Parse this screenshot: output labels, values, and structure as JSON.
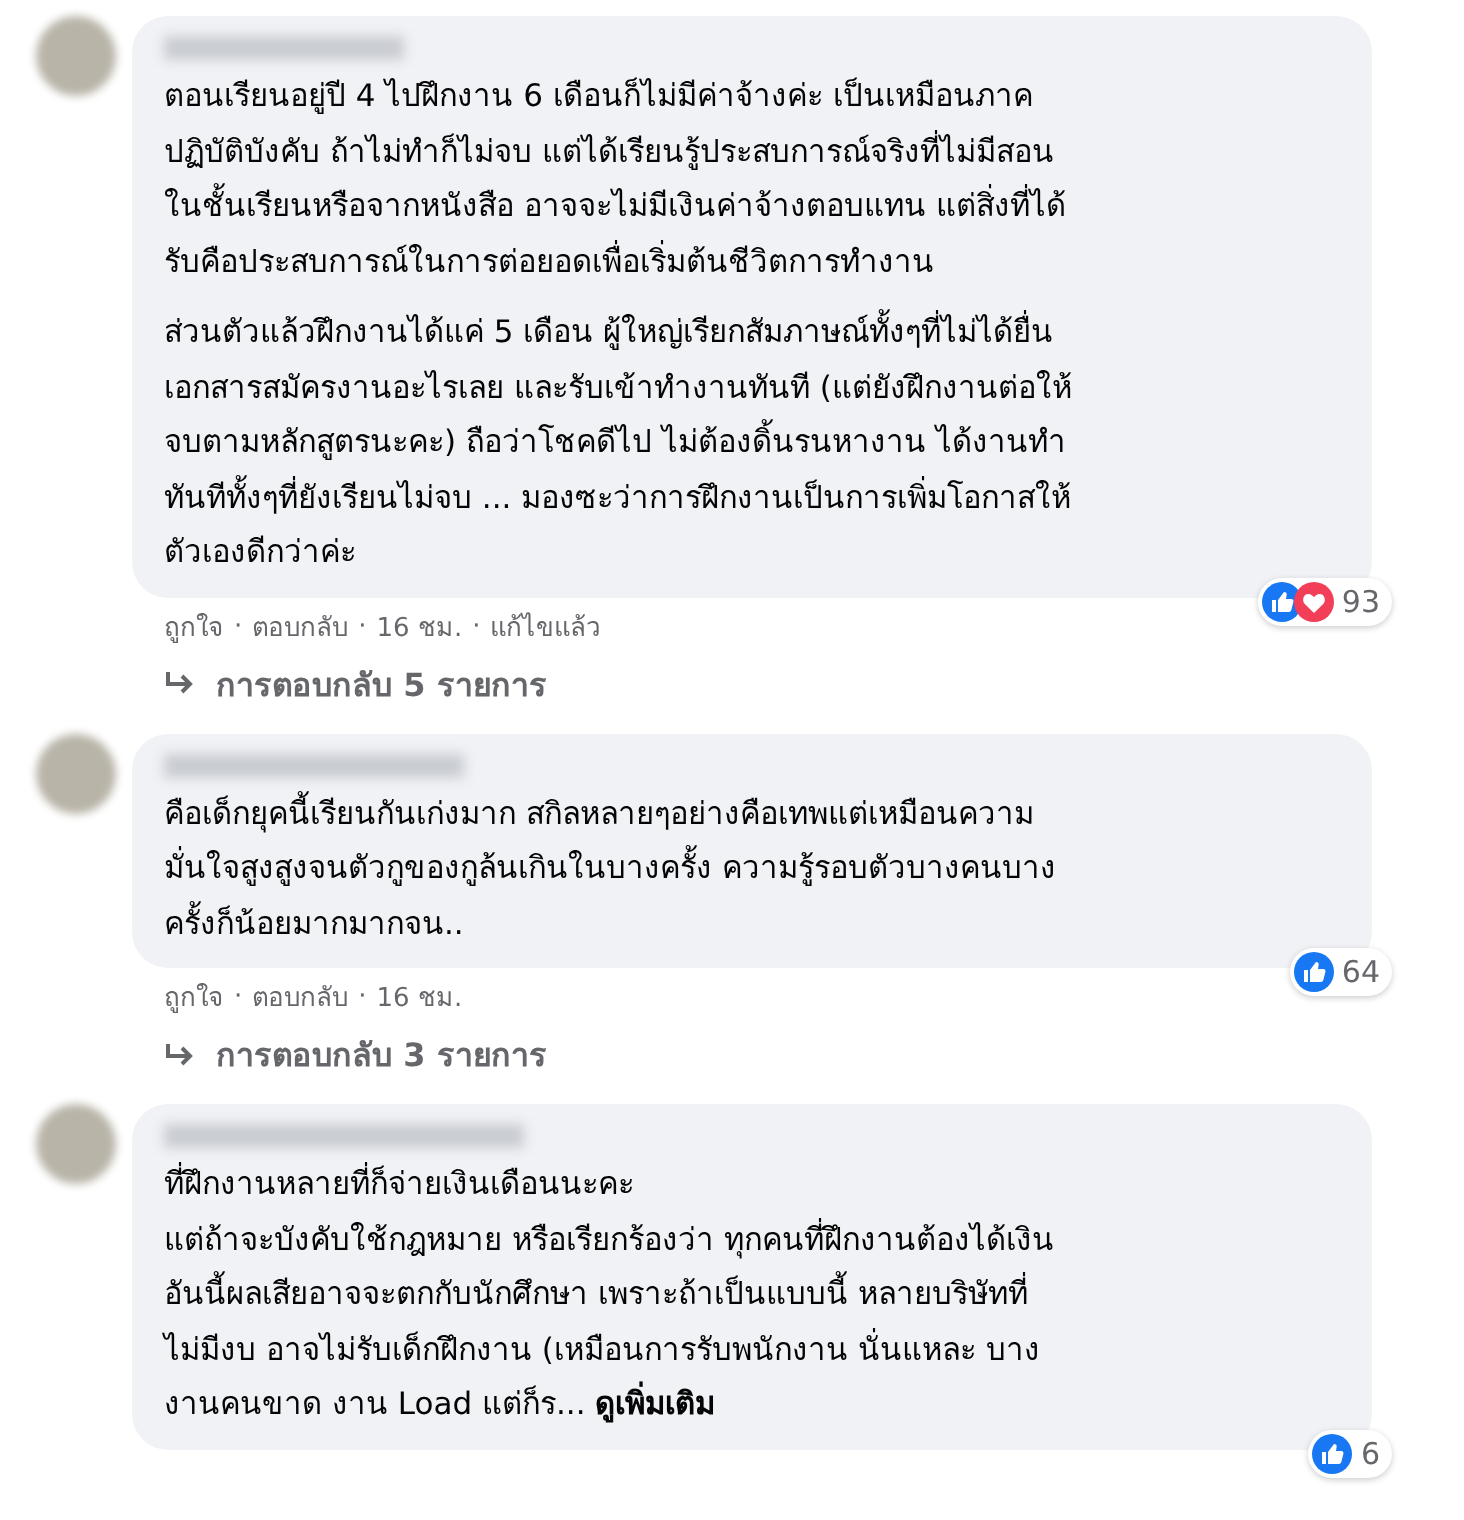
{
  "comments": [
    {
      "paragraphs": [
        "ตอนเรียนอยู่ปี 4 ไปฝึกงาน 6 เดือนก็ไม่มีค่าจ้างค่ะ เป็นเหมือนภาค\nปฏิบัติบังคับ ถ้าไม่ทำก็ไม่จบ แต่ได้เรียนรู้ประสบการณ์จริงที่ไม่มีสอน\nในชั้นเรียนหรือจากหนังสือ อาจจะไม่มีเงินค่าจ้างตอบแทน แต่สิ่งที่ได้\nรับคือประสบการณ์ในการต่อยอดเพื่อเริ่มต้นชีวิตการทำงาน",
        "ส่วนตัวแล้วฝึกงานได้แค่ 5 เดือน ผู้ใหญ่เรียกสัมภาษณ์ทั้งๆที่ไม่ได้ยื่น\nเอกสารสมัครงานอะไรเลย และรับเข้าทำงานทันที (แต่ยังฝึกงานต่อให้\nจบตามหลักสูตรนะคะ) ถือว่าโชคดีไป ไม่ต้องดิ้นรนหางาน ได้งานทำ\nทันทีทั้งๆที่ยังเรียนไม่จบ ... มองซะว่าการฝึกงานเป็นการเพิ่มโอกาสให้\nตัวเองดีกว่าค่ะ"
      ],
      "reactions": [
        {
          "kind": "like"
        },
        {
          "kind": "love"
        }
      ],
      "reaction_count": "93",
      "actions": [
        "ถูกใจ",
        "ตอบกลับ",
        "16 ชม.",
        "แก้ไขแล้ว"
      ],
      "separator": "·",
      "replies": "การตอบกลับ 5 รายการ"
    },
    {
      "paragraphs": [
        "คือเด็กยุคนี้เรียนกันเก่งมาก สกิลหลายๆอย่างคือเทพแต่เหมือนความ\nมั่นใจสูงสูงจนตัวกูของกูล้นเกินในบางครั้ง ความรู้รอบตัวบางคนบาง\nครั้งก็น้อยมากมากจน.."
      ],
      "reactions": [
        {
          "kind": "like"
        }
      ],
      "reaction_count": "64",
      "actions": [
        "ถูกใจ",
        "ตอบกลับ",
        "16 ชม."
      ],
      "separator": "·",
      "replies": "การตอบกลับ 3 รายการ"
    },
    {
      "paragraphs": [
        "ที่ฝึกงานหลายที่ก็จ่ายเงินเดือนนะคะ\nแต่ถ้าจะบังคับใช้กฎหมาย หรือเรียกร้องว่า ทุกคนที่ฝึกงานต้องได้เงิน\nอันนี้ผลเสียอาจจะตกกับนักศึกษา เพราะถ้าเป็นแบบนี้ หลายบริษัทที่\nไม่มีงบ อาจไม่รับเด็กฝึกงาน (เหมือนการรับพนักงาน นั่นแหละ บาง\nงานคนขาด งาน Load แต่ก็ร..."
      ],
      "see_more": "ดูเพิ่มเติม",
      "reactions": [
        {
          "kind": "like"
        }
      ],
      "reaction_count": "6"
    }
  ]
}
